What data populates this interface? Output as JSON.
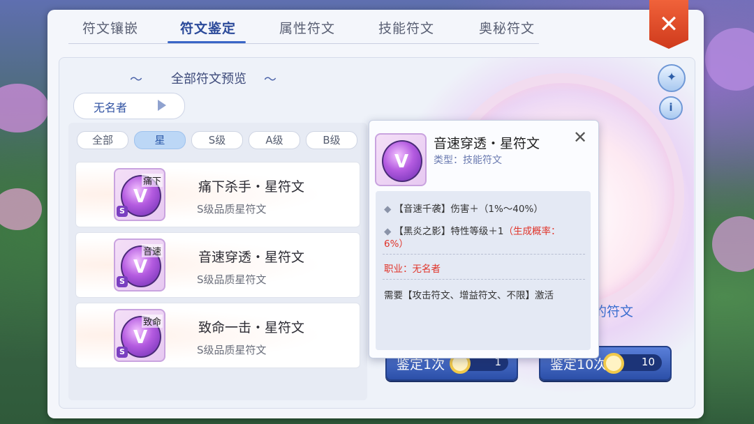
{
  "tabs": [
    {
      "label": "符文镶嵌",
      "active": false
    },
    {
      "label": "符文鉴定",
      "active": true
    },
    {
      "label": "属性符文",
      "active": false
    },
    {
      "label": "技能符文",
      "active": false
    },
    {
      "label": "奥秘符文",
      "active": false
    }
  ],
  "close_label": "✕",
  "preview_title": "全部符文预览",
  "class_selector": {
    "label": "无名者"
  },
  "filters": [
    {
      "label": "全部",
      "active": false
    },
    {
      "label": "星",
      "active": true
    },
    {
      "label": "S级",
      "active": false
    },
    {
      "label": "A级",
      "active": false
    },
    {
      "label": "B级",
      "active": false
    }
  ],
  "runes": [
    {
      "tag": "痛下",
      "grade_badge": "S",
      "name": "痛下杀手・星符文",
      "quality": "S级品质星符文"
    },
    {
      "tag": "音速",
      "grade_badge": "S",
      "name": "音速穿透・星符文",
      "quality": "S级品质星符文"
    },
    {
      "tag": "致命",
      "grade_badge": "S",
      "name": "致命一击・星符文",
      "quality": "S级品质星符文"
    }
  ],
  "right_panel": {
    "text_fragment": "的符文",
    "wand_icon": "wand-icon",
    "info_icon": "info-icon"
  },
  "identify_buttons": [
    {
      "label": "鉴定1次",
      "cost": "1"
    },
    {
      "label": "鉴定10次",
      "cost": "10"
    }
  ],
  "tooltip": {
    "title": "音速穿透・星符文",
    "type": "类型：技能符文",
    "effect1": "【音速千袭】伤害＋（1%～40%）",
    "effect2_main": "【黑炎之影】特性等级＋1",
    "effect2_rate": "（生成概率：",
    "effect2_rate_end": "6%）",
    "job_label": "职业：无名者",
    "requirement": "需要【攻击符文、增益符文、不限】激活"
  },
  "colors": {
    "accent": "#3a66c6",
    "close": "#e0502e",
    "red_text": "#e0342a"
  }
}
